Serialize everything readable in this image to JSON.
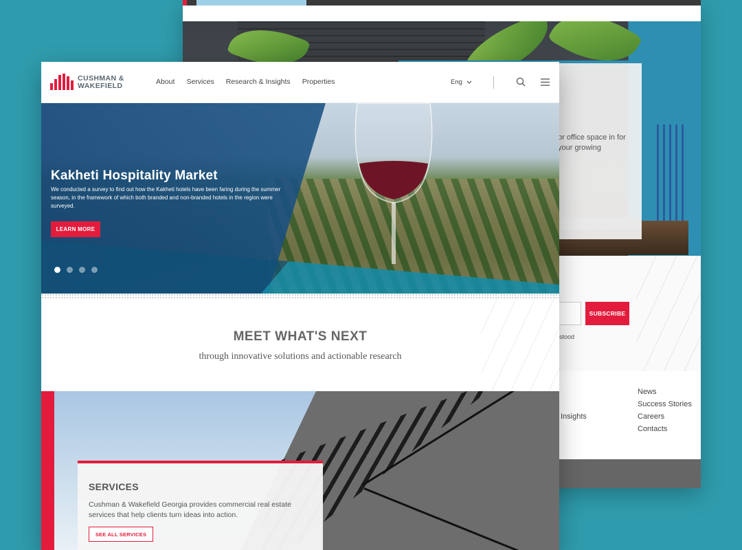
{
  "back_page": {
    "card_text": "or office space in for your growing",
    "subscribe_label": "SUBSCRIBE",
    "consent_fragment": "stood",
    "footer_col_fragment": "Insights",
    "footer_links": [
      "News",
      "Success Stories",
      "Careers",
      "Contacts"
    ]
  },
  "front_page": {
    "logo": {
      "line1": "CUSHMAN &",
      "line2": "WAKEFIELD"
    },
    "nav": {
      "items": [
        "About",
        "Services",
        "Research & Insights",
        "Properties"
      ],
      "language": "Eng"
    },
    "hero": {
      "title": "Kakheti Hospitality Market",
      "text": "We conducted a survey to find out how the Kakheti hotels have been faring during the summer season, in the framework of which both branded and non-branded hotels in the region were surveyed.",
      "button": "LEARN MORE",
      "slides": 4,
      "active_slide": 1
    },
    "tagline": {
      "heading": "MEET WHAT'S NEXT",
      "subheading": "through innovative solutions and actionable research"
    },
    "services": {
      "title": "SERVICES",
      "text": "Cushman & Wakefield Georgia provides commercial real estate services that help clients turn ideas into action.",
      "button": "SEE ALL SERVICES"
    }
  },
  "colors": {
    "background": "#2f9cad",
    "brand_red": "#e31c3d",
    "hero_blue": "#1e5a8c",
    "text_grey": "#555555"
  },
  "icons": [
    "search-icon",
    "hamburger-menu-icon",
    "chevron-down-icon",
    "logo-mark"
  ]
}
